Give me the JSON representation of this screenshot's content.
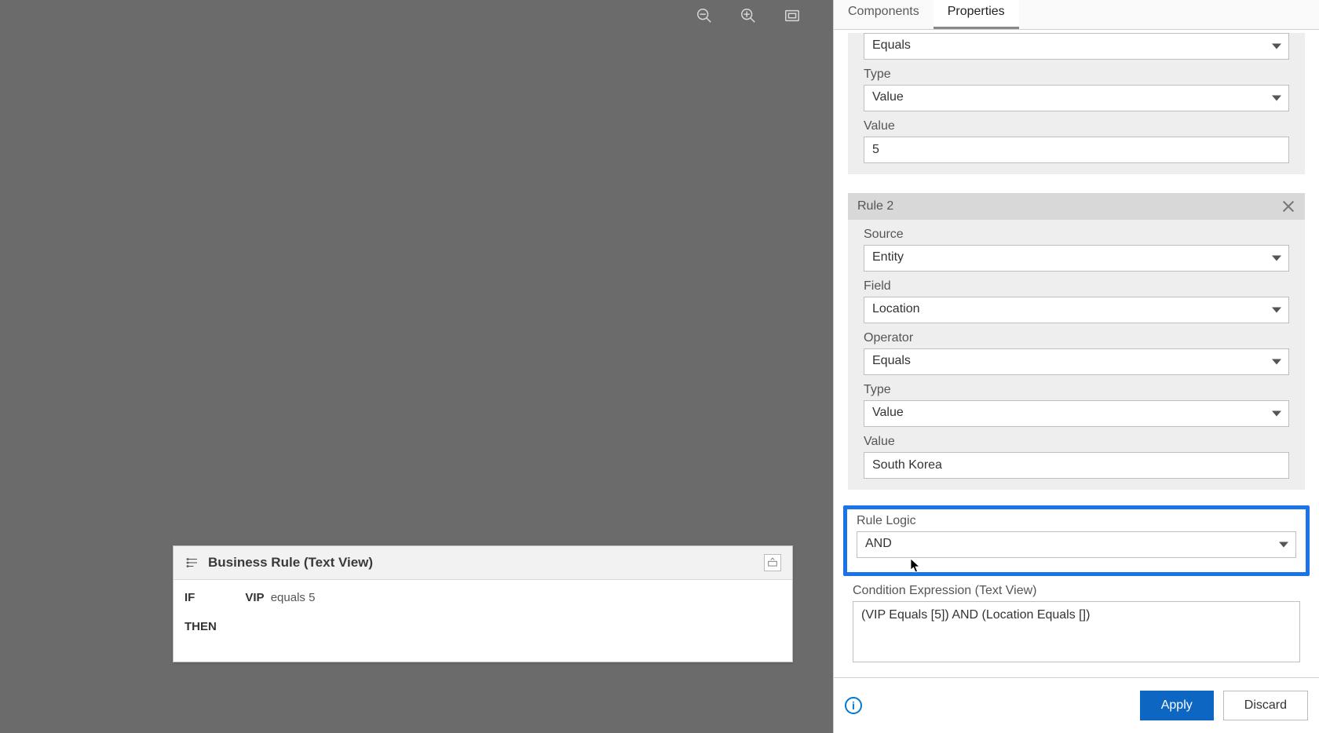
{
  "tabs": {
    "components": "Components",
    "properties": "Properties"
  },
  "rule1": {
    "operator_label": "Equals",
    "type_label": "Type",
    "type_value": "Value",
    "value_label": "Value",
    "value_value": "5"
  },
  "rule2": {
    "header": "Rule 2",
    "source_label": "Source",
    "source_value": "Entity",
    "field_label": "Field",
    "field_value": "Location",
    "operator_label": "Operator",
    "operator_value": "Equals",
    "type_label": "Type",
    "type_value": "Value",
    "value_label": "Value",
    "value_value": "South Korea"
  },
  "logic": {
    "label": "Rule Logic",
    "value": "AND"
  },
  "condition": {
    "label": "Condition Expression (Text View)",
    "value": "(VIP Equals [5]) AND (Location Equals [])"
  },
  "footer": {
    "apply": "Apply",
    "discard": "Discard"
  },
  "textview": {
    "title": "Business Rule (Text View)",
    "if": "IF",
    "expr_bold": "VIP",
    "expr_rest": "equals 5",
    "then": "THEN"
  }
}
